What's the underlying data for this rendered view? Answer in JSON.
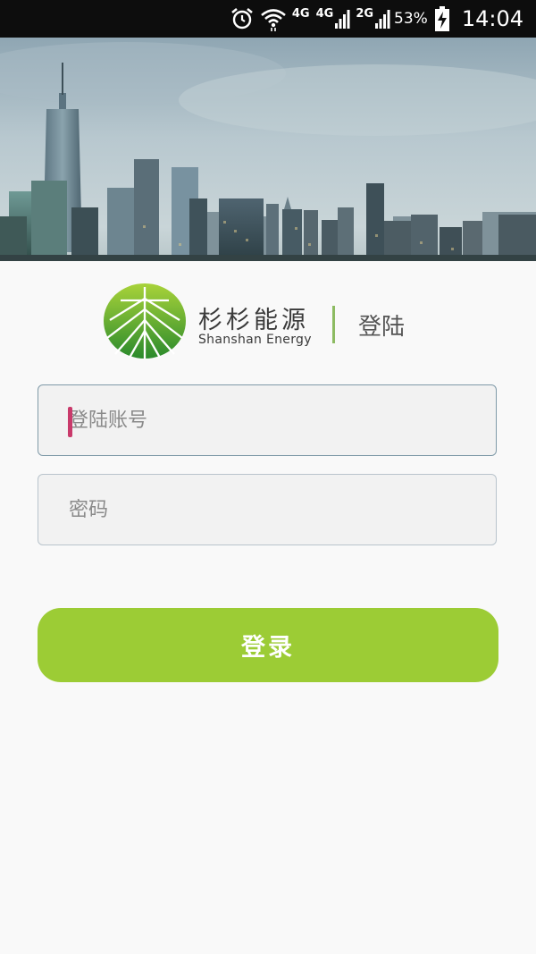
{
  "status_bar": {
    "network_1": "4G",
    "network_2": "4G",
    "network_3": "2G",
    "battery": "53%",
    "time": "14:04"
  },
  "brand": {
    "name_cn": "杉杉能源",
    "name_en": "Shanshan Energy"
  },
  "page_title": "登陆",
  "form": {
    "account_placeholder": "登陆账号",
    "password_placeholder": "密码",
    "submit_label": "登录"
  },
  "colors": {
    "accent": "#9ccc35",
    "divider": "#8dbb62",
    "caret": "#c93a6b"
  }
}
